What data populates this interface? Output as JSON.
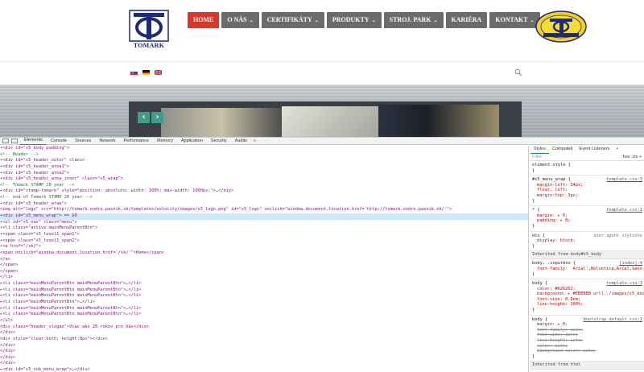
{
  "site": {
    "logo_text": "TOMARK",
    "nav": [
      {
        "label": "HOME",
        "caret": false,
        "active": true
      },
      {
        "label": "O NÁS",
        "caret": true,
        "active": false
      },
      {
        "label": "CERTIFIKÁTY",
        "caret": true,
        "active": false
      },
      {
        "label": "PRODUKTY",
        "caret": true,
        "active": false
      },
      {
        "label": "STROJ. PARK",
        "caret": true,
        "active": false
      },
      {
        "label": "KARIÉRA",
        "caret": false,
        "active": false
      },
      {
        "label": "KONTAKT",
        "caret": true,
        "active": false
      }
    ],
    "flags": [
      "slovak-flag-icon",
      "german-flag-icon",
      "uk-flag-icon"
    ],
    "colors": {
      "nav_bg": "#6b6b6b",
      "nav_active": "#d9372a",
      "slider_arrow": "#3f9b8c",
      "brand_blue": "#1d2a7a"
    }
  },
  "devtools": {
    "tabs": [
      "Elements",
      "Console",
      "Sources",
      "Network",
      "Performance",
      "Memory",
      "Application",
      "Security",
      "Audits"
    ],
    "more": "»",
    "side_tabs": [
      "Styles",
      "Computed",
      "Event Listeners",
      "»"
    ],
    "filter_placeholder": "Filter",
    "filter_options": ":hov  .cls  +",
    "dom_lines": [
      "▾<div id=\"s5_body_padding\">",
      "  <!-- Header -->",
      "  ▾<div id=\"s5_header_outer\" class>",
      "    ▾<div id=\"s5_header_area1\">",
      "      ▾<div id=\"s5_header_area2\">",
      "        ▾<div id=\"s5_header_area_inner\" class=\"s5_wrap\">",
      "          <!--  Tomark STAMP 20 year -->",
      "          ▸<div id=\"stamp-tomark\" style=\"position: absolute; width: 100%; max-width: 1000px;\">…</div>",
      "          <!--  end of Tomark STAMP 20 year -->",
      "          ▾<div id=\"s5_header_wrap\">",
      "            <img alt=\"logo\" src=\"http://tomark.ondre.pasnik.sk/templates/velocity/images/s5_logo.png\" id=\"s5_logo\" onclick=\"window.document.location.href='http://tomark.ondre.pasnik.sk/'\">",
      "          ▾<div id=\"s5_menu_wrap\"> == $0",
      "            ▾<ul id=\"s5_nav\" class=\"menu\">",
      "              ▾<li class=\"active mainMenuParentBtn\">",
      "                ▾<span class=\"s5_level1_span1\">",
      "                  ▾<span class=\"s5_level1_span2\">",
      "                    ▾<a href=\"/sk/\">",
      "                      <span onclick=\"window.document.location.href='/sk/'\">Home</span>",
      "                    </a>",
      "                  </span>",
      "                </span>",
      "              </li>",
      "              ▸<li class=\"mainMenuParentBtn mainMenuParentBtn\">…</li>",
      "              ▸<li class=\"mainMenuParentBtn mainMenuParentBtn\">…</li>",
      "              ▸<li class=\"mainMenuParentBtn mainMenuParentBtn\">…</li>",
      "              ▸<li class=\"mainMenuParentBtn\">…</li>",
      "              ▸<li class=\"mainMenuParentBtn mainMenuParentBtn\">…</li>",
      "              ▸<li class=\"mainMenuParentBtn mainMenuParentBtn\">…</li>",
      "            </ul>",
      "            <div class=\"header_slogan\">Viac ako 20 rokov pre Vás</div>",
      "          </div>",
      "          <div style=\"clear:both; height:8px\"></div>",
      "        </div>",
      "      </div>",
      "    </div>",
      "  </div>",
      "  ▸<div id=\"s5_sub_menu_wrap\">…</div>",
      "  ▸<div>"
    ],
    "selected_line": 11,
    "style_rules": [
      {
        "selector": "element.style {",
        "source": "",
        "props": [],
        "close": "}"
      },
      {
        "selector": "#s5_menu_wrap {",
        "source": "template.css:3",
        "props": [
          "margin-left: 34px;",
          "float: left;",
          "margin-top: 3px;"
        ],
        "close": "}"
      },
      {
        "selector": "* {",
        "source": "template.css:1",
        "props": [
          "margin: ▸ 0;",
          "padding: ▸ 0;"
        ],
        "close": "}"
      },
      {
        "selector": "div {",
        "source": "user agent styleshe",
        "props": [
          "display: block;"
        ],
        "close": "}"
      }
    ],
    "inherited1": "Inherited from body#s5_body",
    "body_rule1": {
      "selector": "body, .inputbox {",
      "source": "[index]:4",
      "props": [
        "font-family: 'Arial',Helvetica,Arial,Sans-Serif;"
      ]
    },
    "body_rule2": {
      "selector": "body {",
      "source": "template.css:3",
      "props": [
        "color: #626262;",
        "background: ▸ #EBEBEB url(../images/s5_body_bg.png);",
        "font-size: 0.8em;",
        "line-height: 100%;"
      ]
    },
    "body_rule3": {
      "selector": "body {",
      "source": "bootstrap-default.css:1",
      "props": [
        "margin: ▸ 0;",
        "font-family: auto;",
        "font-size: auto;",
        "line-height: auto;",
        "color: auto;",
        "background-color: auto;"
      ]
    },
    "inherited2": "Inherited from html"
  }
}
